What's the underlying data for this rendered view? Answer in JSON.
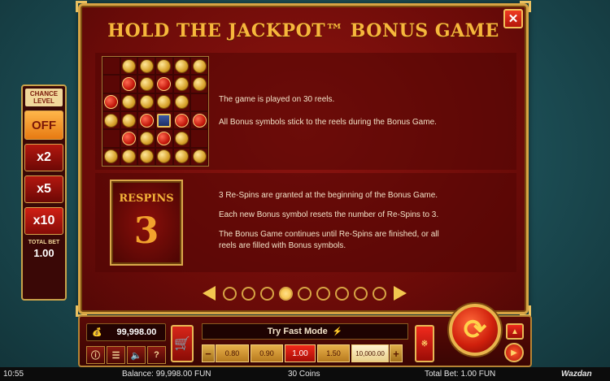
{
  "chance_panel": {
    "title_line1": "CHANCE",
    "title_line2": "LEVEL",
    "buttons": [
      "OFF",
      "x2",
      "x5",
      "x10"
    ],
    "total_bet_label": "TOTAL BET",
    "total_bet_value": "1.00"
  },
  "dialog": {
    "title": "HOLD THE JACKPOT™ BONUS GAME",
    "close_label": "✕",
    "section1": {
      "line1": "The game is played on 30 reels.",
      "line2": "All Bonus symbols stick to the reels during the Bonus Game."
    },
    "section2": {
      "respins_label": "RESPINS",
      "respins_number": "3",
      "line1": "3 Re-Spins are granted at the beginning of the Bonus Game.",
      "line2": "Each new Bonus symbol resets the number of Re-Spins to 3.",
      "line3a": "The Bonus Game continues until Re-Spins are finished, or all",
      "line3b": "reels are filled with Bonus symbols."
    },
    "pagination": {
      "total_pages": 9,
      "current_page": 4
    }
  },
  "controls": {
    "balance": "99,998.00",
    "fast_mode_label": "Try Fast Mode",
    "bet_options": [
      "0.80",
      "0.90",
      "1.00",
      "1.50",
      "10,000.00"
    ],
    "selected_bet": "1.00",
    "minus": "−",
    "plus": "+"
  },
  "status_bar": {
    "time": "10:55",
    "balance": "Balance: 99,998.00 FUN",
    "coins": "30 Coins",
    "total_bet": "Total Bet: 1.00 FUN",
    "brand": "Wazdan"
  },
  "colors": {
    "accent_gold": "#d7a444",
    "dialog_red": "#8e1410",
    "title_orange": "#f6b73c"
  }
}
